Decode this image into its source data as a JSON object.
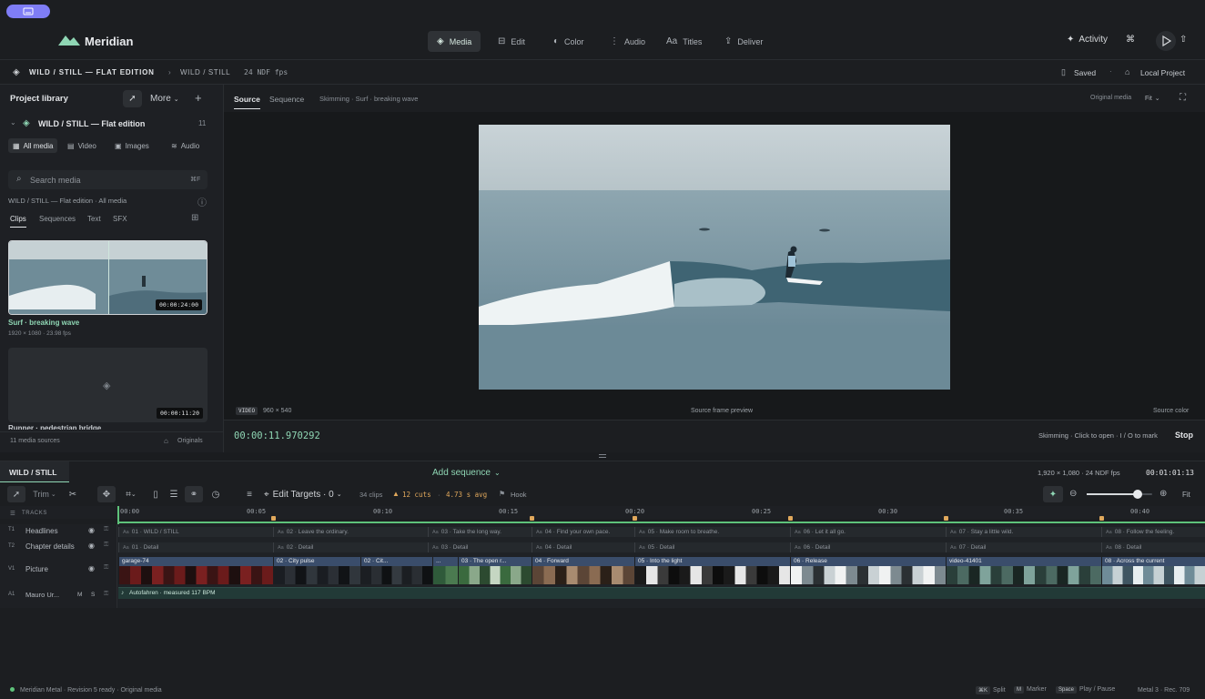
{
  "app": {
    "name": "Meridian",
    "nav": [
      {
        "label": "Media",
        "icon": "layers-icon"
      },
      {
        "label": "Edit",
        "icon": "film-edit-icon"
      },
      {
        "label": "Color",
        "icon": "half-circle-icon"
      },
      {
        "label": "Audio",
        "icon": "waveform-icon"
      },
      {
        "label": "Titles",
        "icon": "text-aa-icon"
      },
      {
        "label": "Deliver",
        "icon": "export-icon"
      }
    ],
    "activity_label": "Activity"
  },
  "breadcrumb": {
    "project": "WILD / STILL — FLAT EDITION",
    "sequence": "WILD / STILL",
    "fps": "24 NDF fps",
    "saved": "Saved",
    "location": "Local Project"
  },
  "library": {
    "title": "Project library",
    "more": "More",
    "project_name": "WILD / STILL — Flat edition",
    "project_count": "11",
    "media_tabs": [
      "All media",
      "Video",
      "Images",
      "Audio"
    ],
    "search_placeholder": "Search media",
    "search_shortcut": "⌘F",
    "path": "WILD / STILL — Flat edition · All media",
    "clip_tabs": [
      "Clips",
      "Sequences",
      "Text",
      "SFX"
    ],
    "clips": [
      {
        "name": "Surf · breaking wave",
        "meta": "1920 × 1080 · 23.98 fps",
        "duration": "00:00:24:00"
      },
      {
        "name": "Runner · pedestrian bridge",
        "meta": "",
        "duration": "00:00:11:20"
      }
    ],
    "footer_count": "11 media sources",
    "footer_mode": "Originals"
  },
  "viewer": {
    "tabs": [
      "Source",
      "Sequence"
    ],
    "skimming": "Skimming · Surf · breaking wave",
    "original_media": "Original media",
    "fit": "Fit",
    "badge": "VIDEO",
    "resolution": "960 × 540",
    "caption": "Source frame preview",
    "source_color": "Source color",
    "timecode": "00:00:11.970292",
    "hint": "Skimming · Click to open · I / O to mark",
    "stop": "Stop"
  },
  "timeline": {
    "name": "WILD / STILL",
    "add_sequence": "Add sequence",
    "format": "1,920 × 1,080 · 24 NDF fps",
    "timecode": "00:01:01:13",
    "trim": "Trim",
    "edit_targets": "Edit Targets · 0",
    "clips_count": "34 clips",
    "cuts": "12 cuts",
    "avg": "4.73 s avg",
    "hook": "Hook",
    "fit": "Fit",
    "zoom_level": 0.78,
    "tracks_label": "TRACKS",
    "ruler": [
      "00:00",
      "00:05",
      "00:10",
      "00:15",
      "00:20",
      "00:25",
      "00:30",
      "00:35",
      "00:40"
    ],
    "tracks": [
      {
        "id": "T1",
        "name": "Headlines"
      },
      {
        "id": "T2",
        "name": "Chapter details"
      },
      {
        "id": "V1",
        "name": "Picture"
      },
      {
        "id": "A1",
        "name": "Mauro Ur...",
        "m": "M",
        "s": "S"
      }
    ],
    "t1_clips": [
      "01 · WILD / STILL",
      "02 · Leave the ordinary.",
      "03 · Take the long way.",
      "04 · Find your own pace.",
      "05 · Make room to breathe.",
      "06 · Let it all go.",
      "07 · Stay a little wild.",
      "08 · Follow the feeling."
    ],
    "t2_clips": [
      "01 · Detail",
      "02 · Detail",
      "03 · Detail",
      "04 · Detail",
      "05 · Detail",
      "06 · Detail",
      "07 · Detail",
      "08 · Detail"
    ],
    "v1_clips": [
      "garage-74",
      "02 · City pulse",
      "02 · Cit...",
      "...",
      "03 · The open r...",
      "04 · Forward",
      "05 · Into the light",
      "06 · Release",
      "video-41401",
      "08 · Across the current"
    ],
    "audio_clip": "Autofahren · measured 117 BPM"
  },
  "status": {
    "left": "Meridian Metal · Revision 5 ready · Original media",
    "shortcuts": [
      {
        "key": "⌘K",
        "label": "Split"
      },
      {
        "key": "M",
        "label": "Marker"
      },
      {
        "key": "Space",
        "label": "Play / Pause"
      }
    ],
    "right": "Metal 3 · Rec. 709"
  },
  "colors": {
    "accent": "#8fd6b4",
    "playhead": "#5ec27a",
    "marker": "#e0a85c",
    "window_btn": "#7f7df6"
  }
}
